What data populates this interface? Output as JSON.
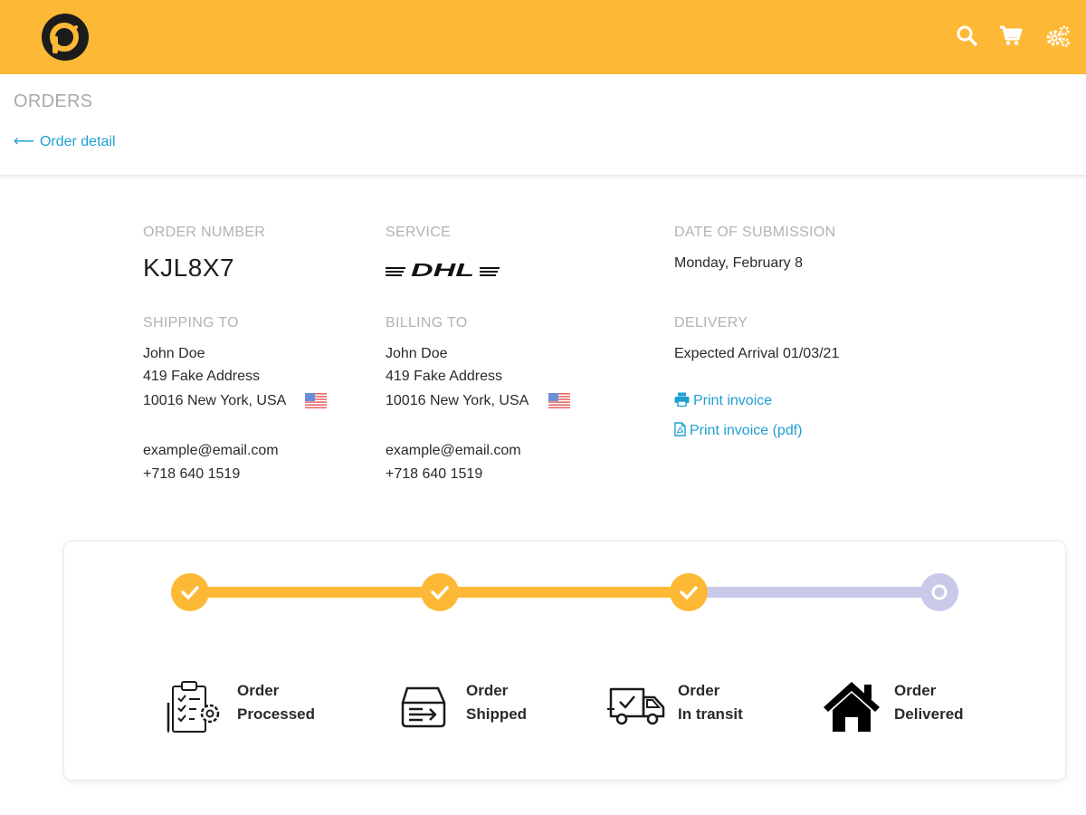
{
  "app": {
    "logo_letter": "p"
  },
  "colors": {
    "accent": "#FDB935",
    "link": "#1e9fd1",
    "pending_track": "#c9c9ea"
  },
  "header": {
    "icons": [
      "search-icon",
      "cart-icon",
      "settings-gears-icon"
    ]
  },
  "page": {
    "title": "ORDERS",
    "back_arrow": "⟵",
    "back_label": "Order detail"
  },
  "order": {
    "number_label": "ORDER NUMBER",
    "number": "KJL8X7",
    "service_label": "SERVICE",
    "service_name": "DHL",
    "date_label": "DATE OF SUBMISSION",
    "date": "Monday, February 8"
  },
  "shipping": {
    "label": "SHIPPING TO",
    "name": "John Doe",
    "street": "419 Fake Address",
    "city": "10016 New York, USA",
    "email": "example@email.com",
    "phone": "+718 640 1519"
  },
  "billing": {
    "label": "BILLING TO",
    "name": "John Doe",
    "street": "419 Fake Address",
    "city": "10016 New York, USA",
    "email": "example@email.com",
    "phone": "+718 640 1519"
  },
  "delivery": {
    "label": "DELIVERY",
    "expected": "Expected Arrival 01/03/21",
    "print_invoice": "Print invoice",
    "print_invoice_pdf": "Print invoice (pdf)"
  },
  "tracker": {
    "steps": [
      {
        "line1": "Order",
        "line2": "Processed",
        "completed": true,
        "icon": "clipboard-gear-icon"
      },
      {
        "line1": "Order",
        "line2": "Shipped",
        "completed": true,
        "icon": "package-box-icon"
      },
      {
        "line1": "Order",
        "line2": "In transit",
        "completed": true,
        "icon": "delivery-truck-icon"
      },
      {
        "line1": "Order",
        "line2": "Delivered",
        "completed": false,
        "icon": "home-icon"
      }
    ]
  }
}
